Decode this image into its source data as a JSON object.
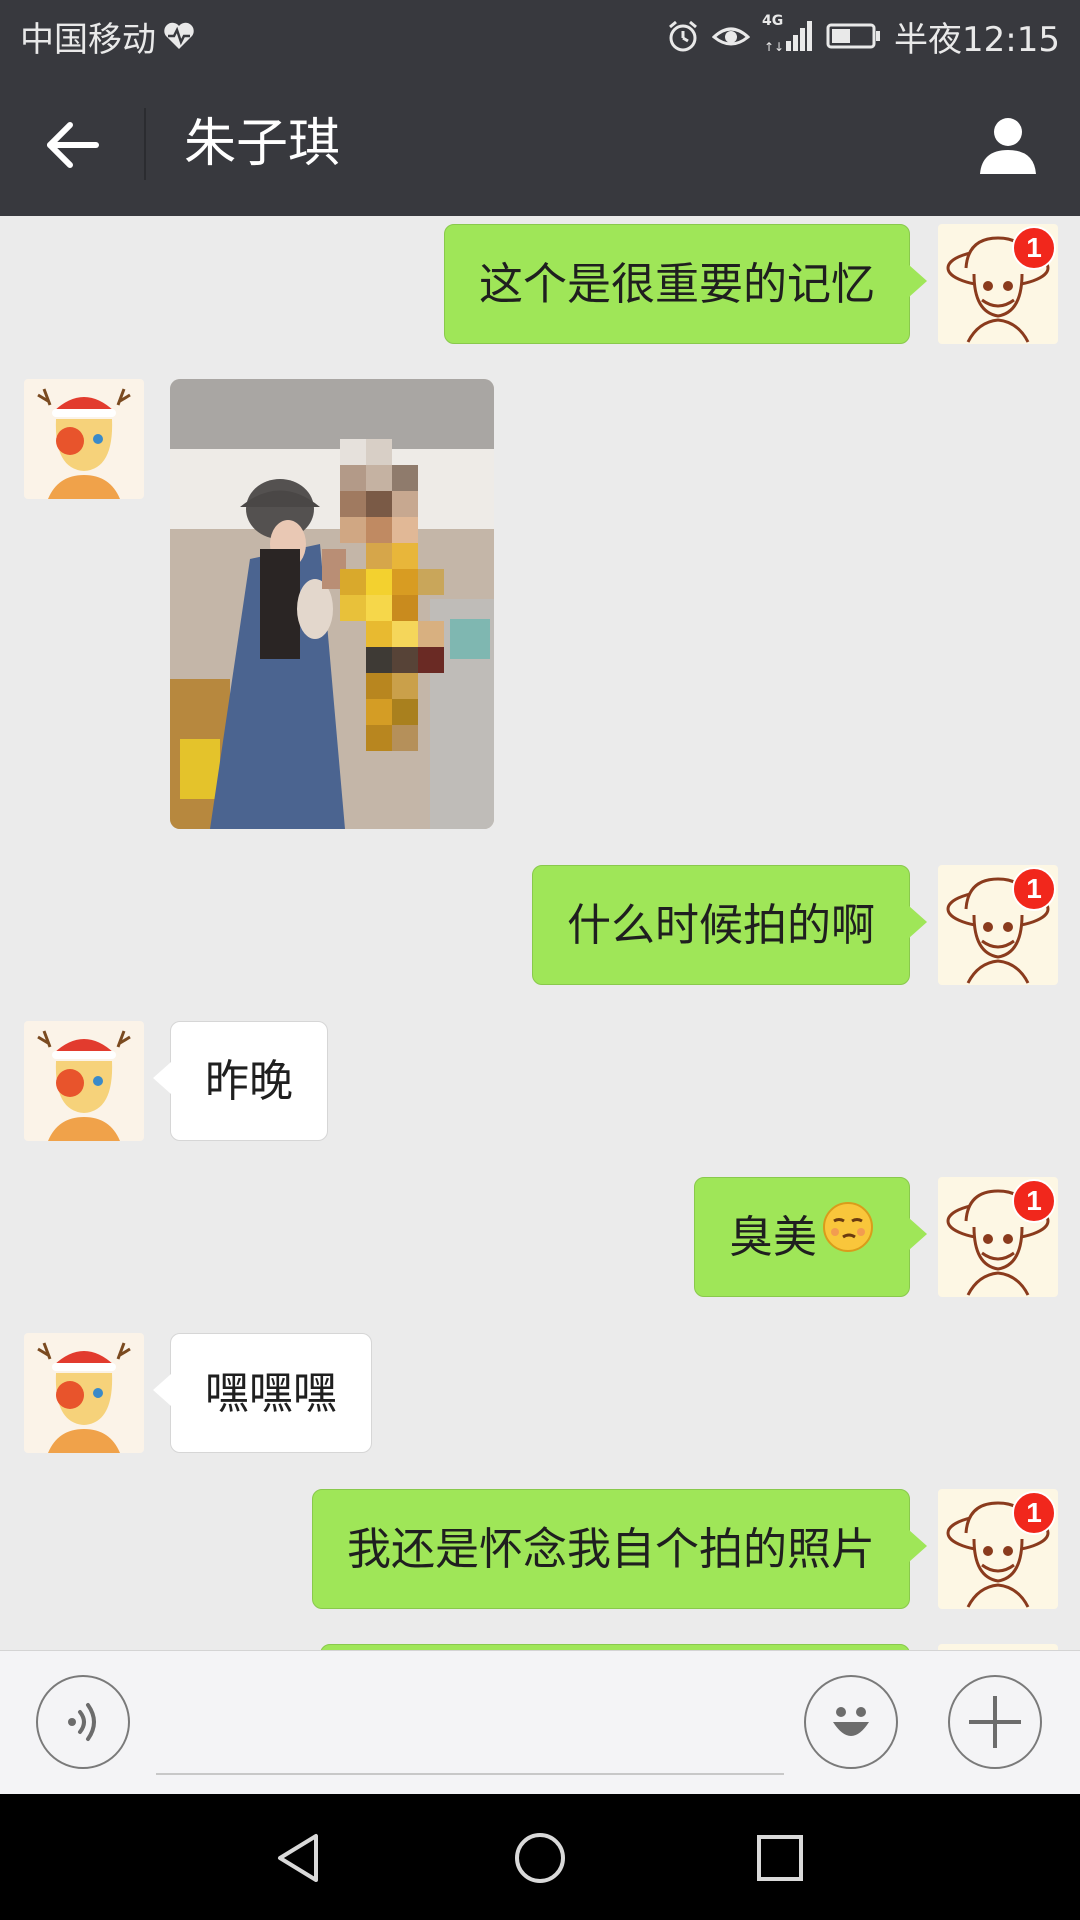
{
  "status_bar": {
    "carrier": "中国移动",
    "network": "4G",
    "time": "半夜12:15"
  },
  "header": {
    "title": "朱子琪"
  },
  "messages": [
    {
      "side": "me",
      "type": "text",
      "text": "这个是很重要的记忆",
      "badge": "1"
    },
    {
      "side": "friend",
      "type": "image"
    },
    {
      "side": "me",
      "type": "text",
      "text": "什么时候拍的啊",
      "badge": "1"
    },
    {
      "side": "friend",
      "type": "text",
      "text": "昨晚"
    },
    {
      "side": "me",
      "type": "text",
      "text": "臭美",
      "emoji": "smirk-emoji",
      "badge": "1"
    },
    {
      "side": "friend",
      "type": "text",
      "text": "嘿嘿嘿"
    },
    {
      "side": "me",
      "type": "text",
      "text": "我还是怀念我自个拍的照片",
      "badge": "1"
    }
  ],
  "input_bar": {
    "placeholder": "",
    "icons": [
      "voice-icon",
      "emoji-icon",
      "plus-icon"
    ]
  },
  "nav_bar": {
    "icons": [
      "nav-back-icon",
      "nav-home-icon",
      "nav-recent-icon"
    ]
  },
  "colors": {
    "header_bg": "#38393e",
    "my_bubble": "#9fe658",
    "friend_bubble": "#ffffff",
    "chat_bg": "#ebebeb",
    "badge": "#f1271c"
  }
}
